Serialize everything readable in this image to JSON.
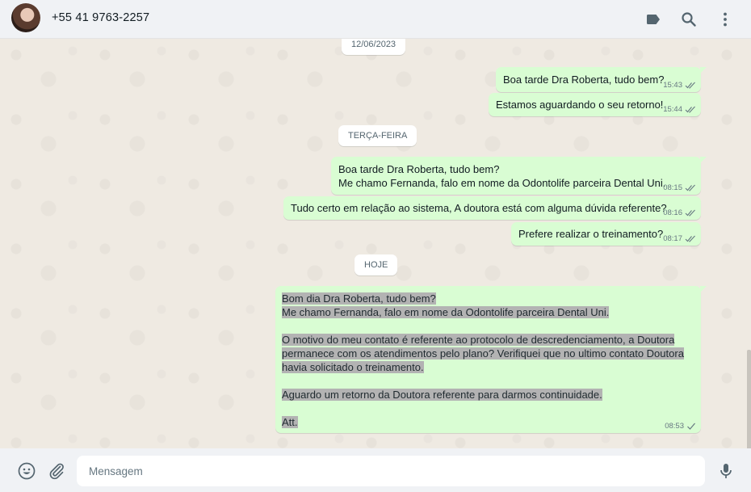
{
  "header": {
    "contact_name": "+55 41 9763-2257",
    "icons": [
      "label-icon",
      "search-icon",
      "menu-icon"
    ]
  },
  "chat": {
    "date_labels": [
      "12/06/2023",
      "TERÇA-FEIRA",
      "HOJE"
    ],
    "messages": [
      {
        "text": "Boa tarde Dra Roberta, tudo bem?",
        "time": "15:43"
      },
      {
        "text": "Estamos aguardando o seu retorno!",
        "time": "15:44"
      },
      {
        "text": "Boa tarde Dra Roberta, tudo bem?\nMe chamo Fernanda, falo em nome da Odontolife parceira Dental Uni.",
        "time": "08:15"
      },
      {
        "text": "Tudo certo em relação ao sistema, A doutora está com alguma dúvida referente?",
        "time": "08:16"
      },
      {
        "text": "Prefere realizar o treinamento?",
        "time": "08:17"
      },
      {
        "lines": [
          "Bom dia Dra Roberta, tudo bem?",
          "Me chamo Fernanda, falo em nome da Odontolife parceira Dental Uni.",
          "",
          "O motivo do meu contato é referente ao protocolo de descredenciamento, a Doutora",
          "permanece com os atendimentos pelo plano? Verifiquei que no ultimo contato Doutora",
          "havia solicitado o treinamento.",
          "",
          "Aguardo um retorno da Doutora referente para darmos continuidade.",
          "",
          "Att."
        ],
        "time": "08:53"
      }
    ]
  },
  "footer": {
    "placeholder": "Mensagem",
    "icons": [
      "emoji-icon",
      "attach-icon",
      "mic-icon"
    ]
  },
  "colors": {
    "outgoing_bubble": "#d9fdd3",
    "chat_background": "#efeae2",
    "read_ticks": "#53bdeb",
    "panel": "#f0f2f5"
  }
}
